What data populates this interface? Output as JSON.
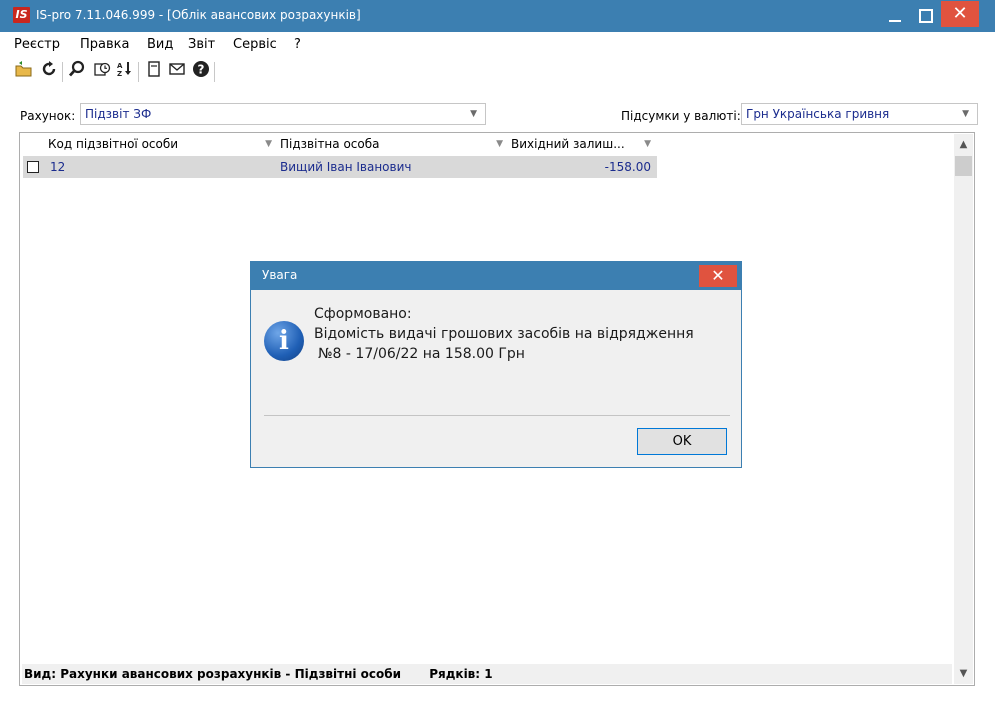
{
  "window": {
    "logo": "IS",
    "title": "IS-pro 7.11.046.999 - [Облік авансових розрахунків]",
    "close_glyph": "✕"
  },
  "menu": [
    "Реєстр",
    "Правка",
    "Вид",
    "Звіт",
    "Сервіс",
    "?"
  ],
  "toolbar": {
    "icons": [
      "open-folder-icon",
      "refresh-icon",
      "search-icon",
      "calc-icon",
      "sort-icon",
      "page-icon",
      "mail-icon",
      "help-icon"
    ]
  },
  "account": {
    "label": "Рахунок:",
    "value": "Підзвіт ЗФ"
  },
  "currency": {
    "label": "Підсумки у валюті:",
    "value": "Грн Українська гривня"
  },
  "grid": {
    "columns": [
      "Код підзвітної особи",
      "Підзвітна особа",
      "Вихідний залиш..."
    ],
    "rows": [
      {
        "code": "12",
        "person": "Вищий Іван Іванович",
        "balance": "-158.00"
      }
    ]
  },
  "status": {
    "view": "Вид: Рахунки авансових розрахунків - Підзвітні особи",
    "rows": "Рядків: 1"
  },
  "dialog": {
    "title": "Увага",
    "line1": "Сформовано:",
    "line2": "Відомість видачі грошових засобів на відрядження",
    "line3": "№8 - 17/06/22 на 158.00 Грн",
    "ok": "OK",
    "close_glyph": "✕"
  }
}
